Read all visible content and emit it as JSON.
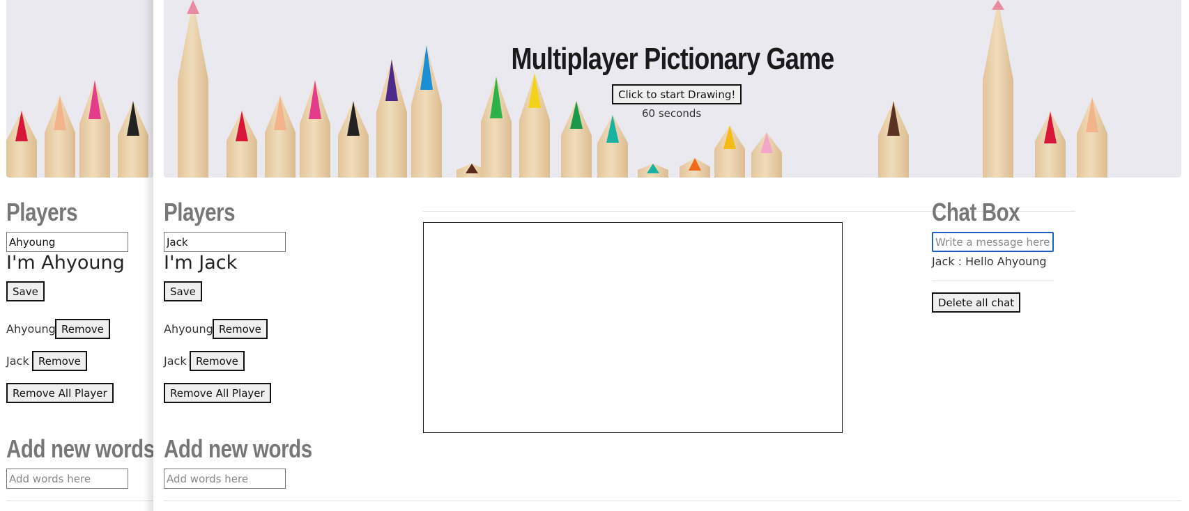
{
  "title": "Multiplayer Pictionary Game",
  "start_button": "Click to start Drawing!",
  "timer": "60 seconds",
  "left_window": {
    "players_heading": "Players",
    "name_input_value": "Ahyoung",
    "greeting": "I'm Ahyoung",
    "save_label": "Save",
    "players": [
      {
        "name": "Ahyoung",
        "remove_label": "Remove"
      },
      {
        "name": "Jack",
        "remove_label": "Remove"
      }
    ],
    "remove_all_label": "Remove All Player",
    "add_words_heading": "Add new words",
    "add_words_placeholder": "Add words here"
  },
  "main_window": {
    "players_heading": "Players",
    "name_input_value": "Jack",
    "greeting": "I'm Jack",
    "save_label": "Save",
    "players": [
      {
        "name": "Ahyoung",
        "remove_label": "Remove"
      },
      {
        "name": "Jack",
        "remove_label": "Remove"
      }
    ],
    "remove_all_label": "Remove All Player",
    "add_words_heading": "Add new words",
    "add_words_placeholder": "Add words here",
    "chat": {
      "heading": "Chat Box",
      "input_placeholder": "Write a message here",
      "messages": [
        "Jack : Hello Ahyoung"
      ],
      "delete_label": "Delete all chat"
    }
  },
  "colors": {
    "heading_gray": "#777777",
    "banner_bg": "#ebe9f0",
    "chat_focus_border": "#1f5fbf"
  }
}
